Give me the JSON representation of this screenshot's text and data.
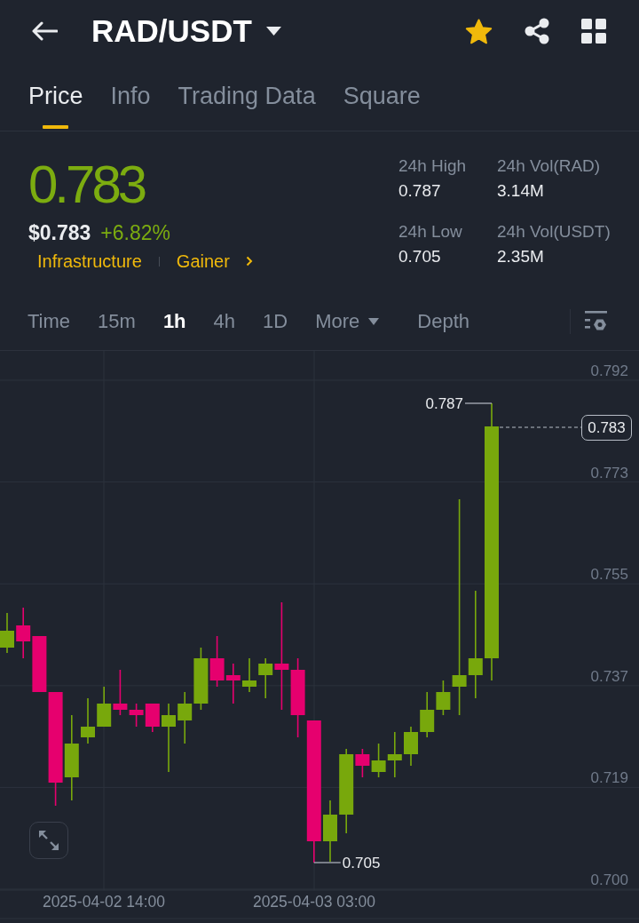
{
  "header": {
    "title": "RAD/USDT",
    "favorite": true
  },
  "tabs": [
    {
      "label": "Price",
      "selected": true
    },
    {
      "label": "Info",
      "selected": false
    },
    {
      "label": "Trading Data",
      "selected": false
    },
    {
      "label": "Square",
      "selected": false
    }
  ],
  "quote": {
    "price": "0.783",
    "positive": true,
    "fiat_price": "$0.783",
    "change": "+6.82%",
    "tags": [
      "Infrastructure",
      "Gainer"
    ]
  },
  "stats": [
    {
      "label": "24h High",
      "value": "0.787"
    },
    {
      "label": "24h Vol(RAD)",
      "value": "3.14M"
    },
    {
      "label": "24h Low",
      "value": "0.705"
    },
    {
      "label": "24h Vol(USDT)",
      "value": "2.35M"
    }
  ],
  "intervals": [
    {
      "label": "Time",
      "kind": "option",
      "selected": false
    },
    {
      "label": "15m",
      "kind": "option",
      "selected": false
    },
    {
      "label": "1h",
      "kind": "option",
      "selected": true
    },
    {
      "label": "4h",
      "kind": "option",
      "selected": false
    },
    {
      "label": "1D",
      "kind": "option",
      "selected": false
    },
    {
      "label": "More",
      "kind": "menu",
      "selected": false
    },
    {
      "label": "Depth",
      "kind": "view",
      "selected": false
    }
  ],
  "chart": {
    "price_axis": [
      "0.792",
      "0.773",
      "0.755",
      "0.737",
      "0.719",
      "0.700"
    ],
    "time_axis": [
      "2025-04-02 14:00",
      "2025-04-03 03:00"
    ],
    "high_label": "0.787",
    "low_label": "0.705",
    "last_price": "0.783"
  }
}
